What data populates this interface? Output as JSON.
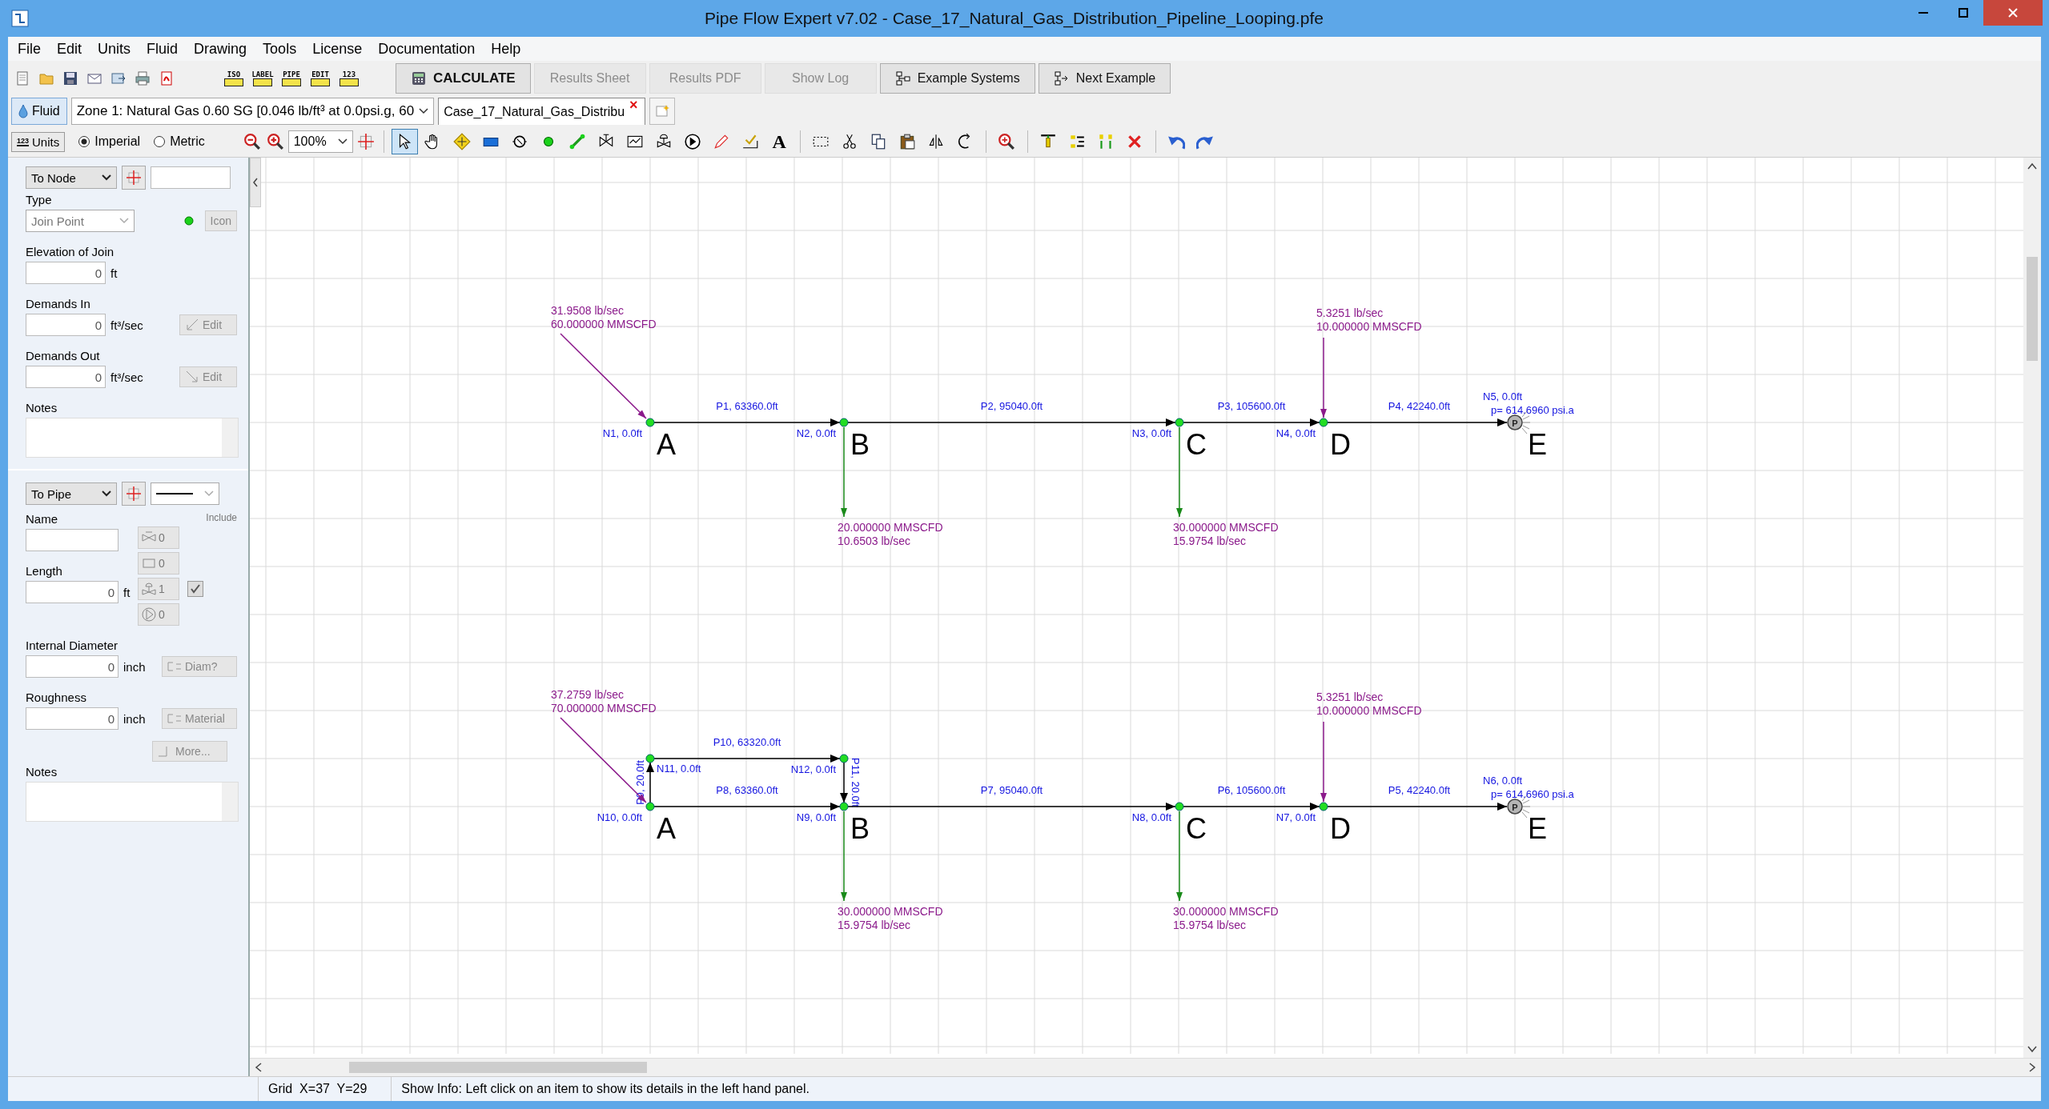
{
  "window": {
    "title": "Pipe Flow Expert v7.02 - Case_17_Natural_Gas_Distribution_Pipeline_Looping.pfe"
  },
  "menu": [
    "File",
    "Edit",
    "Units",
    "Fluid",
    "Drawing",
    "Tools",
    "License",
    "Documentation",
    "Help"
  ],
  "view_tools": [
    "ISO",
    "LABEL",
    "PIPE",
    "EDIT",
    "123"
  ],
  "actions": [
    {
      "label": "CALCULATE",
      "kind": "calculate",
      "disabled": false
    },
    {
      "label": "Results Sheet",
      "kind": "plain",
      "disabled": true
    },
    {
      "label": "Results PDF",
      "kind": "plain",
      "disabled": true
    },
    {
      "label": "Show Log",
      "kind": "plain",
      "disabled": true
    },
    {
      "label": "Example Systems",
      "kind": "systems",
      "disabled": false
    },
    {
      "label": "Next Example",
      "kind": "next",
      "disabled": false
    }
  ],
  "fluid_button": "Fluid",
  "zone": "Zone 1: Natural Gas 0.60 SG [0.046 lb/ft³ at 0.0psi.g, 60",
  "tabs": [
    {
      "label": "Case_17_Natural_Gas_Distribu",
      "selected": true,
      "close": "×"
    }
  ],
  "units_button": {
    "icon_text": "123",
    "label": "Units"
  },
  "unit_systems": [
    {
      "label": "Imperial",
      "selected": true
    },
    {
      "label": "Metric",
      "selected": false
    }
  ],
  "zoom": "100%",
  "drawing_tools": [
    {
      "kind": "pointer",
      "selected": true
    },
    {
      "kind": "hand",
      "selected": false
    },
    {
      "kind": "pan",
      "selected": false
    },
    {
      "kind": "tank",
      "selected": false
    },
    {
      "kind": "component",
      "selected": false
    },
    {
      "kind": "node",
      "selected": false
    },
    {
      "kind": "pipe",
      "selected": false
    },
    {
      "kind": "valve",
      "selected": false
    },
    {
      "kind": "meter",
      "selected": false
    },
    {
      "kind": "regulator",
      "selected": false
    },
    {
      "kind": "pump",
      "selected": false
    },
    {
      "kind": "pencil",
      "selected": false
    },
    {
      "kind": "demand",
      "selected": false
    },
    {
      "kind": "text",
      "glyph": "A",
      "selected": false
    },
    {
      "kind": "select",
      "selected": false
    },
    {
      "kind": "cut",
      "selected": false
    },
    {
      "kind": "copy",
      "selected": false
    },
    {
      "kind": "paste",
      "selected": false
    },
    {
      "kind": "flip",
      "selected": false
    },
    {
      "kind": "rotate",
      "selected": false
    },
    {
      "kind": "zoom",
      "selected": false
    },
    {
      "kind": "align",
      "selected": false
    },
    {
      "kind": "distribute",
      "selected": false
    },
    {
      "kind": "spread",
      "selected": false
    },
    {
      "kind": "delete",
      "selected": false
    },
    {
      "kind": "undo",
      "selected": false
    },
    {
      "kind": "redo",
      "selected": false
    }
  ],
  "left_panel": {
    "node": {
      "target": "To Node",
      "type_label": "Type",
      "type": "Join Point",
      "icon_button": "Icon",
      "fields": [
        {
          "label": "Elevation of Join",
          "value": "0",
          "unit": "ft"
        },
        {
          "label": "Demands In",
          "value": "0",
          "unit": "ft³/sec",
          "button": "Edit"
        },
        {
          "label": "Demands Out",
          "value": "0",
          "unit": "ft³/sec",
          "button": "Edit"
        }
      ],
      "notes_label": "Notes"
    },
    "pipe": {
      "target": "To Pipe",
      "name_label": "Name",
      "include_label": "Include",
      "include_checked": true,
      "length": {
        "label": "Length",
        "value": "0",
        "unit": "ft"
      },
      "components": [
        {
          "kind": "valve",
          "count": "0"
        },
        {
          "kind": "fitting",
          "count": "0"
        },
        {
          "kind": "regulator",
          "count": "1"
        },
        {
          "kind": "pump",
          "count": "0"
        }
      ],
      "diameter": {
        "label": "Internal Diameter",
        "value": "0",
        "unit": "inch",
        "button": "Diam?"
      },
      "roughness": {
        "label": "Roughness",
        "value": "0",
        "unit": "inch",
        "button": "Material"
      },
      "more_button": "More...",
      "notes_label": "Notes"
    }
  },
  "diagram": {
    "networks": [
      {
        "nodes": [
          {
            "kind": "join",
            "label": "N1, 0.0ft",
            "letter": "A"
          },
          {
            "kind": "join",
            "label": "N2, 0.0ft",
            "letter": "B"
          },
          {
            "kind": "join",
            "label": "N3, 0.0ft",
            "letter": "C"
          },
          {
            "kind": "join",
            "label": "N4, 0.0ft",
            "letter": "D"
          },
          {
            "kind": "pressure",
            "label": "N5, 0.0ft",
            "letter": "E",
            "symbol": "P",
            "pressure": "p= 614.6960 psi.a"
          }
        ],
        "pipes": [
          "P1, 63360.0ft",
          "P2, 95040.0ft",
          "P3, 105600.0ft",
          "P4, 42240.0ft"
        ],
        "demands": [
          {
            "kind": "in",
            "lines": [
              "31.9508 lb/sec",
              "60.000000 MMSCFD"
            ]
          },
          {
            "kind": "out",
            "lines": [
              "20.000000 MMSCFD",
              "10.6503 lb/sec"
            ]
          },
          {
            "kind": "out",
            "lines": [
              "30.000000 MMSCFD",
              "15.9754 lb/sec"
            ]
          },
          {
            "kind": "in",
            "lines": [
              "5.3251 lb/sec",
              "10.000000 MMSCFD"
            ]
          }
        ]
      },
      {
        "nodes": [
          {
            "kind": "join",
            "label": "N10, 0.0ft",
            "letter": "A"
          },
          {
            "kind": "join",
            "label": "N9, 0.0ft",
            "letter": "B"
          },
          {
            "kind": "join",
            "label": "N8, 0.0ft",
            "letter": "C"
          },
          {
            "kind": "join",
            "label": "N7, 0.0ft",
            "letter": "D"
          },
          {
            "kind": "pressure",
            "label": "N6, 0.0ft",
            "letter": "E",
            "symbol": "P",
            "pressure": "p= 614.6960 psi.a"
          },
          {
            "kind": "join",
            "label": "N11, 0.0ft"
          },
          {
            "kind": "join",
            "label": "N12, 0.0ft"
          }
        ],
        "pipes": [
          "P10, 63320.0ft",
          "P9, 20.0ft",
          "P11, 20.0ft",
          "P8, 63360.0ft",
          "P7, 95040.0ft",
          "P6, 105600.0ft",
          "P5, 42240.0ft"
        ],
        "demands": [
          {
            "kind": "in",
            "lines": [
              "37.2759 lb/sec",
              "70.000000 MMSCFD"
            ]
          },
          {
            "kind": "out",
            "lines": [
              "30.000000 MMSCFD",
              "15.9754 lb/sec"
            ]
          },
          {
            "kind": "out",
            "lines": [
              "30.000000 MMSCFD",
              "15.9754 lb/sec"
            ]
          },
          {
            "kind": "in",
            "lines": [
              "5.3251 lb/sec",
              "10.000000 MMSCFD"
            ]
          }
        ]
      }
    ]
  },
  "status_bar": {
    "grid": "Grid  X=37  Y=29",
    "info": "Show Info: Left click on an item to show its details in the left hand panel."
  }
}
